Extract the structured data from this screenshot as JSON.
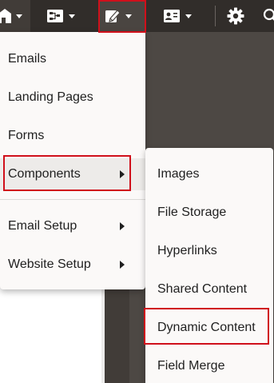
{
  "toolbar": {
    "items": [
      {
        "name": "home",
        "icon": "home-icon",
        "has_dropdown": true
      },
      {
        "name": "campaigns",
        "icon": "campaign-canvas-icon",
        "has_dropdown": true
      },
      {
        "name": "assets",
        "icon": "pencil-edit-icon",
        "has_dropdown": true,
        "active": true
      },
      {
        "name": "contacts",
        "icon": "contact-card-icon",
        "has_dropdown": true
      },
      {
        "name": "settings",
        "icon": "gear-icon"
      },
      {
        "name": "search",
        "icon": "search-icon"
      }
    ],
    "background": "#312d2a"
  },
  "primary_menu": {
    "items": [
      {
        "label": "Emails"
      },
      {
        "label": "Landing Pages"
      },
      {
        "label": "Forms"
      },
      {
        "label": "Components",
        "has_submenu": true,
        "highlighted": true
      },
      {
        "label": "Email Setup",
        "has_submenu": true
      },
      {
        "label": "Website Setup",
        "has_submenu": true
      }
    ]
  },
  "components_submenu": {
    "items": [
      {
        "label": "Images"
      },
      {
        "label": "File Storage"
      },
      {
        "label": "Hyperlinks"
      },
      {
        "label": "Shared Content"
      },
      {
        "label": "Dynamic Content",
        "highlighted": true
      },
      {
        "label": "Field Merge"
      }
    ]
  },
  "colors": {
    "highlight_outline": "#d0101b",
    "menu_background": "#fbf9f8",
    "toolbar_background": "#312d2a"
  }
}
